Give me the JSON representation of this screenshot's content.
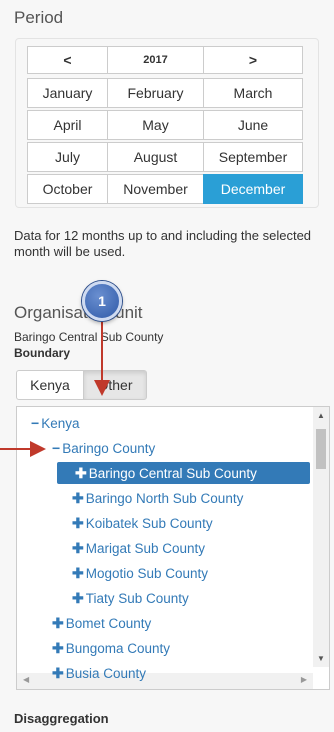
{
  "period": {
    "title": "Period",
    "year_nav": {
      "prev": "<",
      "year": "2017",
      "next": ">"
    },
    "months": [
      [
        "January",
        "February",
        "March"
      ],
      [
        "April",
        "May",
        "June"
      ],
      [
        "July",
        "August",
        "September"
      ],
      [
        "October",
        "November",
        "December"
      ]
    ],
    "selected_month": "December"
  },
  "info_text": "Data for 12 months up to and including the selected month will be used.",
  "org_unit": {
    "title": "Organisation unit",
    "selected_name": "Baringo Central Sub County",
    "boundary_label": "Boundary",
    "boundary_buttons": [
      "Kenya",
      "Other"
    ],
    "tree": [
      {
        "glyph": "−",
        "label": "Kenya",
        "level": 0
      },
      {
        "glyph": "−",
        "label": "Baringo County",
        "level": 1
      },
      {
        "glyph": "✚",
        "label": "Baringo Central Sub County",
        "level": 2,
        "selected": true
      },
      {
        "glyph": "✚",
        "label": "Baringo North Sub County",
        "level": 2
      },
      {
        "glyph": "✚",
        "label": "Koibatek Sub County",
        "level": 2
      },
      {
        "glyph": "✚",
        "label": "Marigat Sub County",
        "level": 2
      },
      {
        "glyph": "✚",
        "label": "Mogotio Sub County",
        "level": 2
      },
      {
        "glyph": "✚",
        "label": "Tiaty Sub County",
        "level": 2
      },
      {
        "glyph": "✚",
        "label": "Bomet County",
        "level": 1
      },
      {
        "glyph": "✚",
        "label": "Bungoma County",
        "level": 1
      },
      {
        "glyph": "✚",
        "label": "Busia County",
        "level": 1
      }
    ]
  },
  "disaggregation": {
    "title": "Disaggregation"
  },
  "callout": {
    "number": "1"
  },
  "colors": {
    "accent": "#2a9fd6",
    "tree_link": "#337ab7",
    "annotation_arrow": "#c0392b"
  }
}
